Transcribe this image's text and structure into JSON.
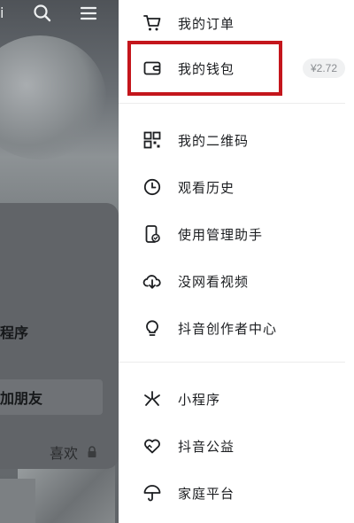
{
  "background": {
    "top_char": "i",
    "card_line1": "程序",
    "card_button": "加朋友",
    "card_like": "喜欢"
  },
  "menu": {
    "items": [
      {
        "label": "我的订单",
        "icon": "cart-icon"
      },
      {
        "label": "我的钱包",
        "icon": "wallet-icon",
        "badge": "¥2.72"
      },
      {
        "label": "我的二维码",
        "icon": "qrcode-icon"
      },
      {
        "label": "观看历史",
        "icon": "clock-icon"
      },
      {
        "label": "使用管理助手",
        "icon": "phone-check-icon"
      },
      {
        "label": "没网看视频",
        "icon": "cloud-download-icon"
      },
      {
        "label": "抖音创作者中心",
        "icon": "lightbulb-icon"
      },
      {
        "label": "小程序",
        "icon": "mini-program-icon"
      },
      {
        "label": "抖音公益",
        "icon": "heart-icon"
      },
      {
        "label": "家庭平台",
        "icon": "umbrella-icon"
      }
    ]
  },
  "colors": {
    "highlight": "#c4161c",
    "text": "#1c1e21",
    "badge_bg": "#f0f1f2"
  }
}
